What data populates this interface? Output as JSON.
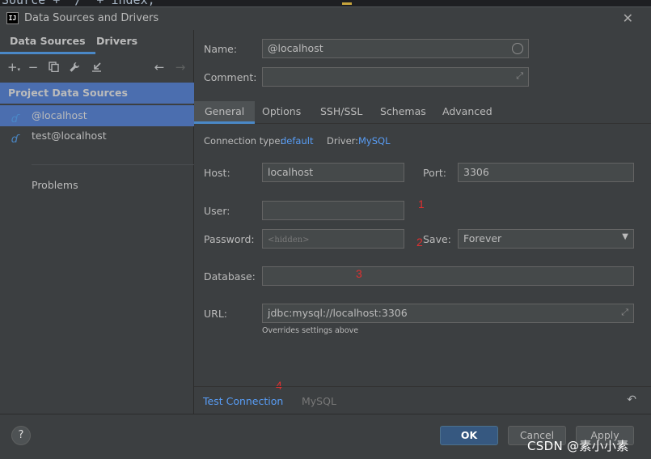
{
  "background_code": {
    "text": "Source + \"/\" + index;"
  },
  "window": {
    "title": "Data Sources and Drivers",
    "app_icon": "IJ",
    "close": "✕"
  },
  "left_panel": {
    "tabs": [
      {
        "label": "Data Sources",
        "active": true
      },
      {
        "label": "Drivers",
        "active": false
      }
    ],
    "toolbar_icons": [
      "add-icon",
      "remove-icon",
      "duplicate-icon",
      "wrench-icon",
      "import-icon",
      "back-arrow-icon",
      "forward-arrow-icon"
    ],
    "section_header": "Project Data Sources",
    "items": [
      {
        "label": "@localhost",
        "selected": true
      },
      {
        "label": "test@localhost",
        "selected": false
      }
    ],
    "problems_label": "Problems"
  },
  "form": {
    "name_label": "Name:",
    "name_value": "@localhost",
    "comment_label": "Comment:",
    "comment_value": "",
    "tabs": [
      {
        "label": "General",
        "active": true
      },
      {
        "label": "Options",
        "active": false
      },
      {
        "label": "SSH/SSL",
        "active": false
      },
      {
        "label": "Schemas",
        "active": false
      },
      {
        "label": "Advanced",
        "active": false
      }
    ],
    "connection_type_label": "Connection type:",
    "connection_type_value": "default",
    "driver_label": "Driver:",
    "driver_value": "MySQL",
    "host_label": "Host:",
    "host_value": "localhost",
    "port_label": "Port:",
    "port_value": "3306",
    "user_label": "User:",
    "user_value": "",
    "password_label": "Password:",
    "password_placeholder": "<hidden>",
    "save_label": "Save:",
    "save_value": "Forever",
    "database_label": "Database:",
    "database_value": "",
    "url_label": "URL:",
    "url_value": "jdbc:mysql://localhost:3306",
    "url_hint": "Overrides settings above",
    "test_connection": "Test Connection",
    "driver_footer": "MySQL"
  },
  "annotations": [
    "1",
    "2",
    "3",
    "4"
  ],
  "annotation_color": "#e03030",
  "buttons": {
    "help": "?",
    "ok": "OK",
    "cancel": "Cancel",
    "apply": "Apply"
  },
  "watermark": "CSDN @素小小素",
  "colors": {
    "accent": "#4a88c7",
    "selection": "#4b6eaf",
    "link": "#589df6",
    "primary_button": "#365880"
  }
}
